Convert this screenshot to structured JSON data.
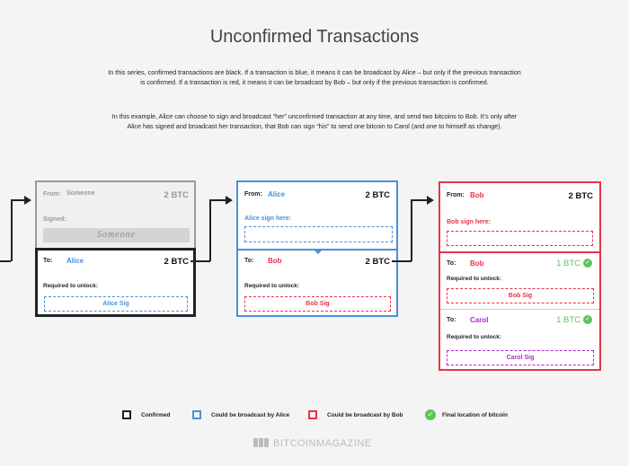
{
  "title": "Unconfirmed Transactions",
  "intro": {
    "p1": "In this series, confirmed transactions are black. If a transaction is blue, it means it can be broadcast by Alice – but only if the previous transaction is confirmed. If a transaction is red, it means it can be broadcast by Bob – but only if the previous transaction is confirmed.",
    "p2": "In this example, Alice can choose to sign and broadcast “her” unconfirmed transaction at any time, and send two bitcoins to Bob. It’s only after Alice has signed and broadcast her transaction, that  Bob can sign “his” to send one bitcoin to Carol (and one to himself as change)."
  },
  "colors": {
    "confirmed": "#222222",
    "alice": "#4a90d9",
    "bob": "#e8334a",
    "carol": "#b026d6",
    "green": "#5dc55a",
    "grey": "#9a9a9a"
  },
  "tx1": {
    "from_label": "From:",
    "from_name": "Someone",
    "from_amount": "2 BTC",
    "signed_label": "Signed:",
    "signature": "Someone",
    "to_label": "To:",
    "to_name": "Alice",
    "to_amount": "2 BTC",
    "required": "Required to unlock:",
    "sig": "Alice Sig"
  },
  "tx2": {
    "from_label": "From:",
    "from_name": "Alice",
    "from_amount": "2 BTC",
    "sign_here": "Alice sign here:",
    "to_label": "To:",
    "to_name": "Bob",
    "to_amount": "2 BTC",
    "required": "Required to unlock:",
    "sig": "Bob Sig"
  },
  "tx3": {
    "from_label": "From:",
    "from_name": "Bob",
    "from_amount": "2 BTC",
    "sign_here": "Bob sign here:",
    "out1": {
      "to_label": "To:",
      "to_name": "Bob",
      "amount": "1 BTC",
      "required": "Required to unlock:",
      "sig": "Bob Sig"
    },
    "out2": {
      "to_label": "To:",
      "to_name": "Carol",
      "amount": "1 BTC",
      "required": "Required to unlock:",
      "sig": "Carol Sig"
    }
  },
  "legend": {
    "confirmed": "Confirmed",
    "alice": "Could be broadcast by Alice",
    "bob": "Could be broadcast by Bob",
    "final": "Final location of bitcoin"
  },
  "brand": {
    "part1": "BITCOIN",
    "part2": "MAGAZINE"
  }
}
